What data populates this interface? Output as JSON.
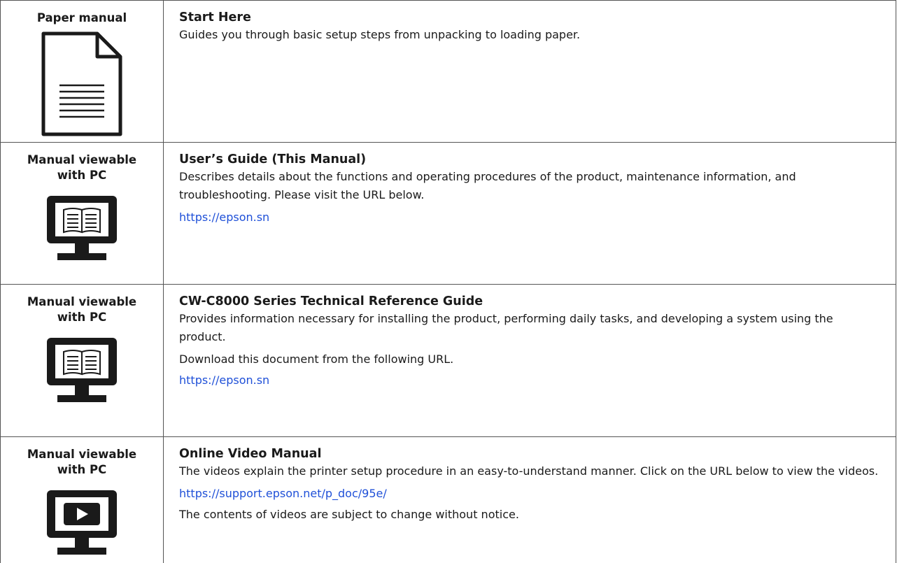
{
  "rows": [
    {
      "category": [
        "Paper manual"
      ],
      "icon": "document-icon",
      "title": "Start Here",
      "description": "Guides you through basic setup steps from unpacking to loading paper."
    },
    {
      "category": [
        "Manual viewable",
        "with PC"
      ],
      "icon": "monitor-book-icon",
      "title": "User’s Guide (This Manual)",
      "description": "Describes details about the functions and operating procedures of the product, maintenance information, and troubleshooting. Please visit the URL below.",
      "link": "https://epson.sn"
    },
    {
      "category": [
        "Manual viewable",
        "with PC"
      ],
      "icon": "monitor-book-icon",
      "title": "CW-C8000 Series Technical Reference Guide",
      "description": "Provides information necessary for installing the product, performing daily tasks, and developing a system using the product.",
      "extra": "Download this document from the following URL.",
      "link": "https://epson.sn"
    },
    {
      "category": [
        "Manual viewable",
        "with PC"
      ],
      "icon": "monitor-play-icon",
      "title": "Online Video Manual",
      "description": "The videos explain the printer setup procedure in an easy-to-understand manner. Click on the URL below to view the videos.",
      "link": "https://support.epson.net/p_doc/95e/",
      "note": "The contents of videos are subject to change without notice."
    }
  ]
}
